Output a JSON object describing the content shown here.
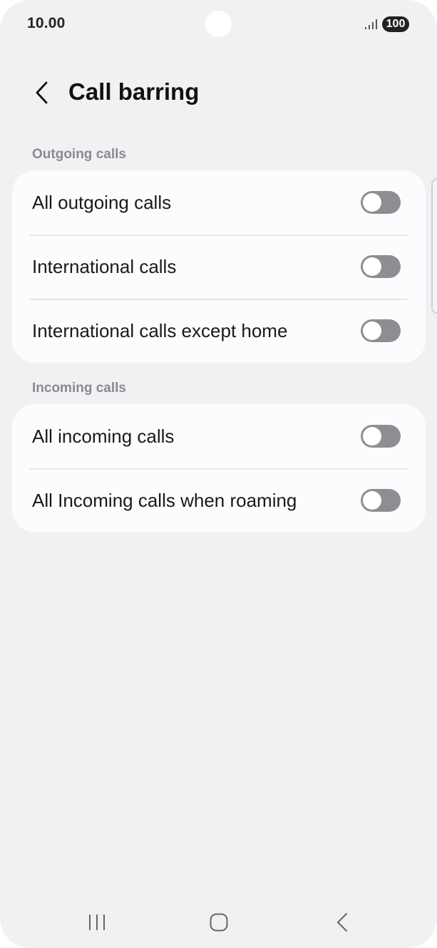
{
  "status_bar": {
    "time": "10.00",
    "battery": "100",
    "signal_icon": "signal-bars-icon"
  },
  "header": {
    "title": "Call barring",
    "back_icon": "chevron-left-icon"
  },
  "sections": [
    {
      "header": "Outgoing calls",
      "items": [
        {
          "label": "All outgoing calls",
          "enabled": false
        },
        {
          "label": "International calls",
          "enabled": false
        },
        {
          "label": "International calls except home",
          "enabled": false
        }
      ]
    },
    {
      "header": "Incoming calls",
      "items": [
        {
          "label": "All incoming calls",
          "enabled": false
        },
        {
          "label": "All Incoming calls when roaming",
          "enabled": false
        }
      ]
    }
  ],
  "nav_bar": {
    "recents_icon": "recents-icon",
    "home_icon": "home-icon",
    "back_icon": "back-icon"
  },
  "colors": {
    "background": "#f1f1f3",
    "card": "#fcfcfe",
    "toggle_off": "#8e8e92",
    "section_header": "#8a8a8f"
  }
}
